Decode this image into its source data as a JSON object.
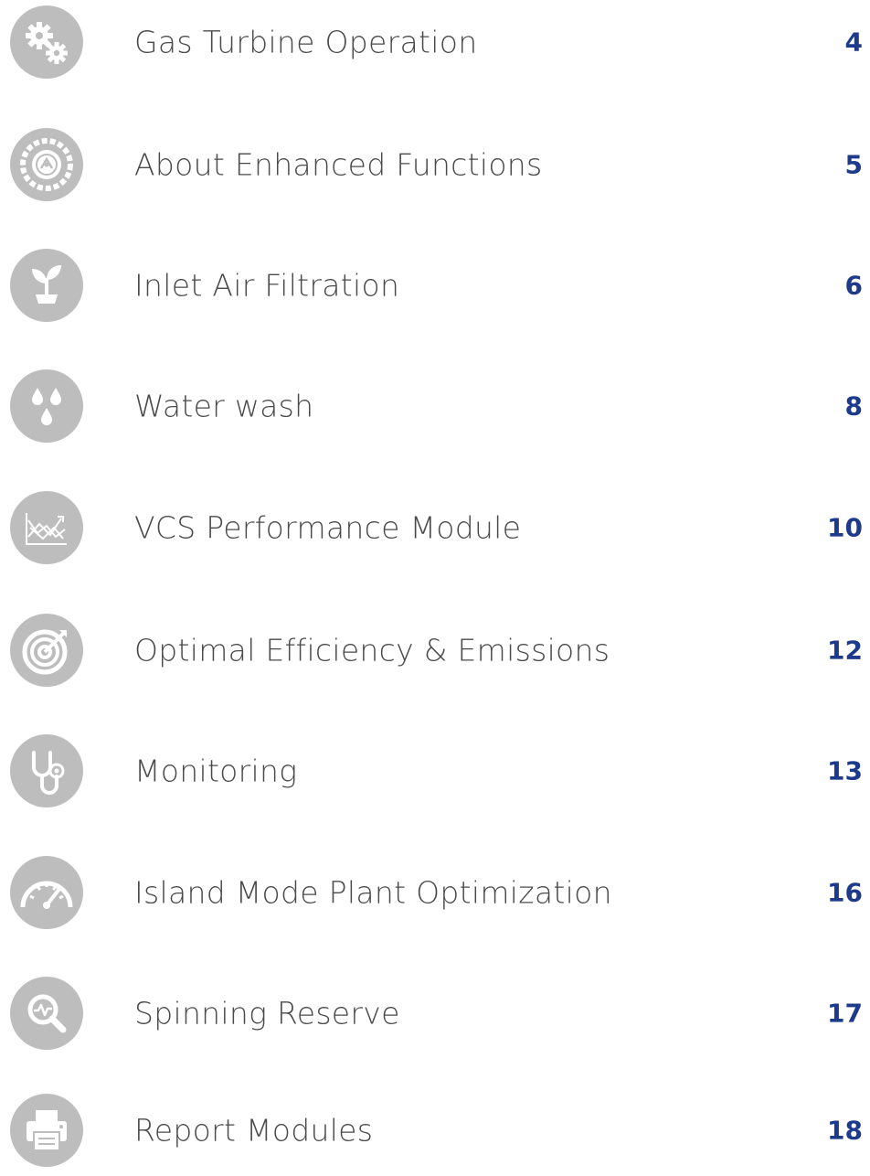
{
  "toc": {
    "items": [
      {
        "title": "Gas Turbine Operation",
        "page": "4",
        "icon": "gears-icon"
      },
      {
        "title": "About Enhanced Functions",
        "page": "5",
        "icon": "compass-dial-icon"
      },
      {
        "title": "Inlet Air Filtration",
        "page": "6",
        "icon": "plant-sprout-icon"
      },
      {
        "title": "Water wash",
        "page": "8",
        "icon": "water-drops-icon"
      },
      {
        "title": "VCS Performance Module",
        "page": "10",
        "icon": "performance-chart-icon"
      },
      {
        "title": "Optimal Efficiency & Emissions",
        "page": "12",
        "icon": "target-icon"
      },
      {
        "title": "Monitoring",
        "page": "13",
        "icon": "stethoscope-icon"
      },
      {
        "title": "Island Mode Plant Optimization",
        "page": "16",
        "icon": "speedometer-icon"
      },
      {
        "title": "Spinning Reserve",
        "page": "17",
        "icon": "magnifier-pulse-icon"
      },
      {
        "title": "Report Modules",
        "page": "18",
        "icon": "printer-icon"
      }
    ]
  },
  "colors": {
    "icon_circle": "#bdbdbd",
    "title_text": "#4a4a4a",
    "page_number": "#1e3a8a"
  }
}
